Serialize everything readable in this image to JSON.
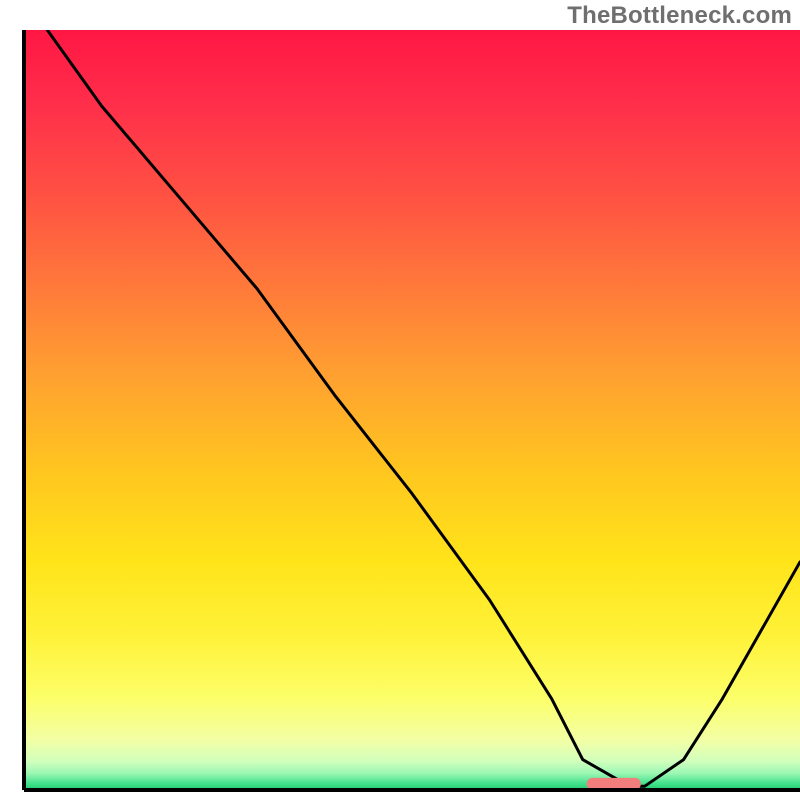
{
  "watermark": "TheBottleneck.com",
  "chart_data": {
    "type": "line",
    "title": "",
    "xlabel": "",
    "ylabel": "",
    "xlim": [
      0,
      100
    ],
    "ylim": [
      0,
      100
    ],
    "series": [
      {
        "name": "bottleneck-curve",
        "x": [
          3,
          10,
          20,
          25,
          30,
          40,
          50,
          60,
          68,
          72,
          78,
          80,
          85,
          90,
          95,
          100
        ],
        "y": [
          100,
          90,
          78,
          72,
          66,
          52,
          39,
          25,
          12,
          4,
          0.5,
          0.5,
          4,
          12,
          21,
          30
        ]
      }
    ],
    "marker": {
      "x_center": 76,
      "x_halfwidth": 3.5,
      "y": 0.8,
      "color": "#f27d7d"
    },
    "background_gradient": {
      "stops": [
        {
          "offset": 0.0,
          "color": "#ff1744"
        },
        {
          "offset": 0.1,
          "color": "#ff2f4a"
        },
        {
          "offset": 0.22,
          "color": "#ff5243"
        },
        {
          "offset": 0.34,
          "color": "#ff7a3a"
        },
        {
          "offset": 0.46,
          "color": "#ffa230"
        },
        {
          "offset": 0.58,
          "color": "#ffc61f"
        },
        {
          "offset": 0.7,
          "color": "#ffe41a"
        },
        {
          "offset": 0.8,
          "color": "#fff23a"
        },
        {
          "offset": 0.88,
          "color": "#fcff6a"
        },
        {
          "offset": 0.935,
          "color": "#f2ffa6"
        },
        {
          "offset": 0.962,
          "color": "#d2ffbd"
        },
        {
          "offset": 0.978,
          "color": "#9cf7b4"
        },
        {
          "offset": 0.992,
          "color": "#3fe08a"
        },
        {
          "offset": 1.0,
          "color": "#23c96e"
        }
      ]
    },
    "axes": {
      "left_x": 3,
      "right_x": 100,
      "bottom_y": 0,
      "top_y": 100
    }
  }
}
